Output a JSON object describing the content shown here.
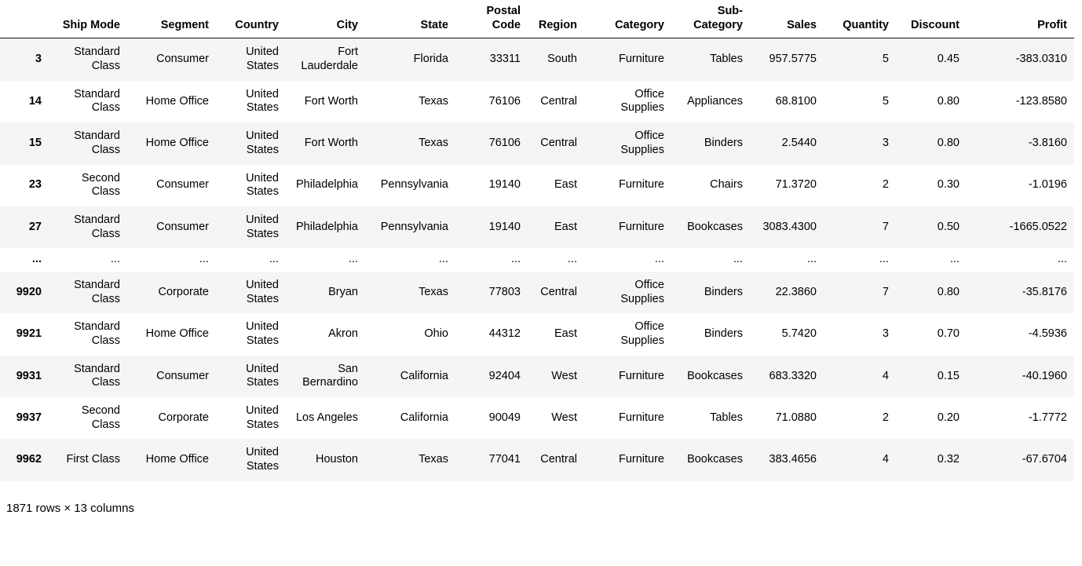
{
  "table": {
    "index_header": "",
    "columns": [
      "Ship Mode",
      "Segment",
      "Country",
      "City",
      "State",
      "Postal Code",
      "Region",
      "Category",
      "Sub-Category",
      "Sales",
      "Quantity",
      "Discount",
      "Profit"
    ],
    "rows": [
      {
        "index": "3",
        "cells": [
          "Standard Class",
          "Consumer",
          "United States",
          "Fort Lauderdale",
          "Florida",
          "33311",
          "South",
          "Furniture",
          "Tables",
          "957.5775",
          "5",
          "0.45",
          "-383.0310"
        ]
      },
      {
        "index": "14",
        "cells": [
          "Standard Class",
          "Home Office",
          "United States",
          "Fort Worth",
          "Texas",
          "76106",
          "Central",
          "Office Supplies",
          "Appliances",
          "68.8100",
          "5",
          "0.80",
          "-123.8580"
        ]
      },
      {
        "index": "15",
        "cells": [
          "Standard Class",
          "Home Office",
          "United States",
          "Fort Worth",
          "Texas",
          "76106",
          "Central",
          "Office Supplies",
          "Binders",
          "2.5440",
          "3",
          "0.80",
          "-3.8160"
        ]
      },
      {
        "index": "23",
        "cells": [
          "Second Class",
          "Consumer",
          "United States",
          "Philadelphia",
          "Pennsylvania",
          "19140",
          "East",
          "Furniture",
          "Chairs",
          "71.3720",
          "2",
          "0.30",
          "-1.0196"
        ]
      },
      {
        "index": "27",
        "cells": [
          "Standard Class",
          "Consumer",
          "United States",
          "Philadelphia",
          "Pennsylvania",
          "19140",
          "East",
          "Furniture",
          "Bookcases",
          "3083.4300",
          "7",
          "0.50",
          "-1665.0522"
        ]
      },
      {
        "index": "...",
        "cells": [
          "...",
          "...",
          "...",
          "...",
          "...",
          "...",
          "...",
          "...",
          "...",
          "...",
          "...",
          "...",
          "..."
        ]
      },
      {
        "index": "9920",
        "cells": [
          "Standard Class",
          "Corporate",
          "United States",
          "Bryan",
          "Texas",
          "77803",
          "Central",
          "Office Supplies",
          "Binders",
          "22.3860",
          "7",
          "0.80",
          "-35.8176"
        ]
      },
      {
        "index": "9921",
        "cells": [
          "Standard Class",
          "Home Office",
          "United States",
          "Akron",
          "Ohio",
          "44312",
          "East",
          "Office Supplies",
          "Binders",
          "5.7420",
          "3",
          "0.70",
          "-4.5936"
        ]
      },
      {
        "index": "9931",
        "cells": [
          "Standard Class",
          "Consumer",
          "United States",
          "San Bernardino",
          "California",
          "92404",
          "West",
          "Furniture",
          "Bookcases",
          "683.3320",
          "4",
          "0.15",
          "-40.1960"
        ]
      },
      {
        "index": "9937",
        "cells": [
          "Second Class",
          "Corporate",
          "United States",
          "Los Angeles",
          "California",
          "90049",
          "West",
          "Furniture",
          "Tables",
          "71.0880",
          "2",
          "0.20",
          "-1.7772"
        ]
      },
      {
        "index": "9962",
        "cells": [
          "First Class",
          "Home Office",
          "United States",
          "Houston",
          "Texas",
          "77041",
          "Central",
          "Furniture",
          "Bookcases",
          "383.4656",
          "4",
          "0.32",
          "-67.6704"
        ]
      }
    ],
    "footer": "1871 rows × 13 columns"
  },
  "colors": {
    "stripe": "#f5f5f5",
    "background": "#ffffff",
    "text": "#000000",
    "header_rule": "#111111"
  }
}
